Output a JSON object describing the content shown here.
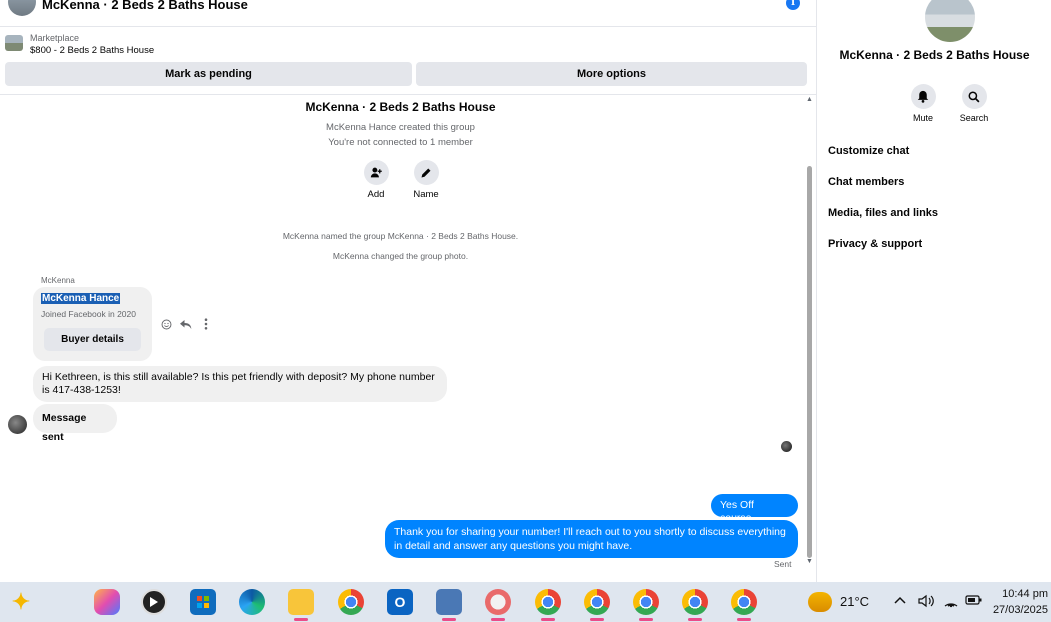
{
  "header": {
    "title": "McKenna · 2 Beds 2 Baths House",
    "info_icon": "info-icon"
  },
  "marketplace": {
    "label": "Marketplace",
    "listing": "$800 - 2 Beds 2 Baths House"
  },
  "actions": {
    "pending": "Mark as pending",
    "more": "More options"
  },
  "thread": {
    "group_name": "McKenna · 2 Beds 2 Baths House",
    "created": "McKenna Hance created this group",
    "not_connected": "You're not connected to 1 member",
    "add_label": "Add",
    "name_label": "Name",
    "system_messages": [
      "McKenna named the group McKenna · 2 Beds 2 Baths House.",
      "McKenna changed the group photo."
    ],
    "sender": "McKenna",
    "card": {
      "name": "McKenna Hance",
      "joined": "Joined Facebook in 2020",
      "button": "Buyer details"
    },
    "incoming": [
      "Hi Kethreen, is this still available? Is this pet friendly with deposit? My phone number is 417-438-1253!",
      "Message sent"
    ],
    "outgoing": [
      "Yes Off course..",
      "Thank you for sharing your number! I'll reach out to you shortly to discuss everything in detail and answer any questions you might have."
    ],
    "status": "Sent"
  },
  "details": {
    "title": "McKenna · 2 Beds 2 Baths House",
    "mute": "Mute",
    "search": "Search",
    "menu": [
      "Customize chat",
      "Chat members",
      "Media, files and links",
      "Privacy & support"
    ]
  },
  "taskbar": {
    "temperature": "21°C",
    "time": "10:44 pm",
    "date": "27/03/2025"
  },
  "colors": {
    "accent": "#0084ff",
    "bubble_in": "#f0f0f0",
    "button_bg": "#e4e6eb"
  }
}
